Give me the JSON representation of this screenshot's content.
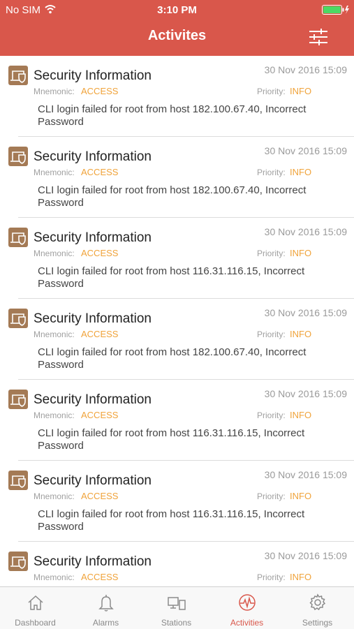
{
  "status_bar": {
    "carrier": "No SIM",
    "time": "3:10 PM"
  },
  "header": {
    "title": "Activites"
  },
  "icons": {
    "filter": "sliders-icon",
    "activity": "security-icon",
    "tabs": [
      "home-icon",
      "bell-icon",
      "stations-icon",
      "pulse-icon",
      "gear-icon"
    ]
  },
  "colors": {
    "accent": "#d9574b",
    "highlight": "#f0a33a",
    "icon_bg": "#a47a55",
    "battery": "#4cd964"
  },
  "activities": [
    {
      "title": "Security Information",
      "date": "30 Nov 2016 15:09",
      "mnemonic_label": "Mnemonic:",
      "mnemonic": "ACCESS",
      "priority_label": "Priority:",
      "priority": "INFO",
      "message": "CLI login failed for root from host 182.100.67.40, Incorrect Password"
    },
    {
      "title": "Security Information",
      "date": "30 Nov 2016 15:09",
      "mnemonic_label": "Mnemonic:",
      "mnemonic": "ACCESS",
      "priority_label": "Priority:",
      "priority": "INFO",
      "message": "CLI login failed for root from host 182.100.67.40, Incorrect Password"
    },
    {
      "title": "Security Information",
      "date": "30 Nov 2016 15:09",
      "mnemonic_label": "Mnemonic:",
      "mnemonic": "ACCESS",
      "priority_label": "Priority:",
      "priority": "INFO",
      "message": "CLI login failed for root from host 116.31.116.15, Incorrect Password"
    },
    {
      "title": "Security Information",
      "date": "30 Nov 2016 15:09",
      "mnemonic_label": "Mnemonic:",
      "mnemonic": "ACCESS",
      "priority_label": "Priority:",
      "priority": "INFO",
      "message": "CLI login failed for root from host 182.100.67.40, Incorrect Password"
    },
    {
      "title": "Security Information",
      "date": "30 Nov 2016 15:09",
      "mnemonic_label": "Mnemonic:",
      "mnemonic": "ACCESS",
      "priority_label": "Priority:",
      "priority": "INFO",
      "message": "CLI login failed for root from host 116.31.116.15, Incorrect Password"
    },
    {
      "title": "Security Information",
      "date": "30 Nov 2016 15:09",
      "mnemonic_label": "Mnemonic:",
      "mnemonic": "ACCESS",
      "priority_label": "Priority:",
      "priority": "INFO",
      "message": "CLI login failed for root from host 116.31.116.15, Incorrect Password"
    },
    {
      "title": "Security Information",
      "date": "30 Nov 2016 15:09",
      "mnemonic_label": "Mnemonic:",
      "mnemonic": "ACCESS",
      "priority_label": "Priority:",
      "priority": "INFO",
      "message": ""
    }
  ],
  "tabbar": {
    "tabs": [
      {
        "label": "Dashboard",
        "active": false
      },
      {
        "label": "Alarms",
        "active": false
      },
      {
        "label": "Stations",
        "active": false
      },
      {
        "label": "Activities",
        "active": true
      },
      {
        "label": "Settings",
        "active": false
      }
    ]
  }
}
